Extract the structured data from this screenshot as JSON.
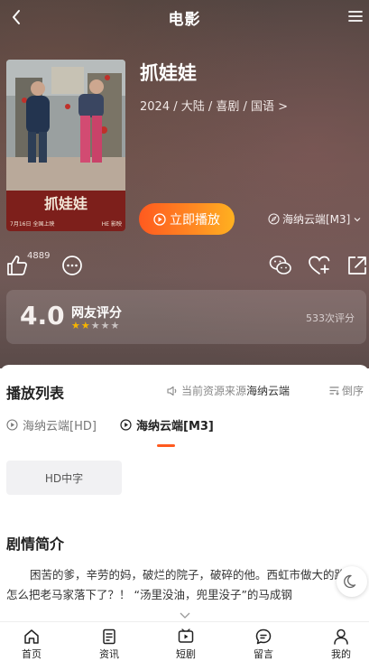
{
  "header": {
    "title": "电影"
  },
  "movie": {
    "title": "抓娃娃",
    "meta": "2024 / 大陆 / 喜剧 / 国语 >",
    "poster": {
      "title_art": "抓娃娃",
      "date_left": "7月16日 全国上映",
      "date_right": "HE 影映"
    }
  },
  "actions": {
    "play_label": "立即播放",
    "source_label": "海纳云端[M3]",
    "like_count": "4889"
  },
  "rating": {
    "score": "4.0",
    "label": "网友评分",
    "stars_filled": 2,
    "stars_total": 5,
    "count_text": "533次评分"
  },
  "playlist": {
    "title": "播放列表",
    "source_note_prefix": "当前资源来源",
    "source_note_current": "海纳云端",
    "sort_label": "倒序",
    "tabs": [
      {
        "label": "海纳云端[HD]",
        "active": false
      },
      {
        "label": "海纳云端[M3]",
        "active": true
      }
    ],
    "episodes": [
      "HD中字"
    ]
  },
  "synopsis": {
    "title": "剧情简介",
    "text": "困苦的爹，辛劳的妈，破烂的院子，破碎的他。西虹市做大的路上怎么把老马家落下了？！  “汤里没油，兜里没子”的马成钢"
  },
  "nav": [
    {
      "label": "首页",
      "icon": "home-icon"
    },
    {
      "label": "资讯",
      "icon": "news-icon"
    },
    {
      "label": "短剧",
      "icon": "short-drama-icon"
    },
    {
      "label": "留言",
      "icon": "message-icon"
    },
    {
      "label": "我的",
      "icon": "profile-icon"
    }
  ],
  "colors": {
    "accent": "#ff5a1f",
    "star": "#f5b400"
  }
}
